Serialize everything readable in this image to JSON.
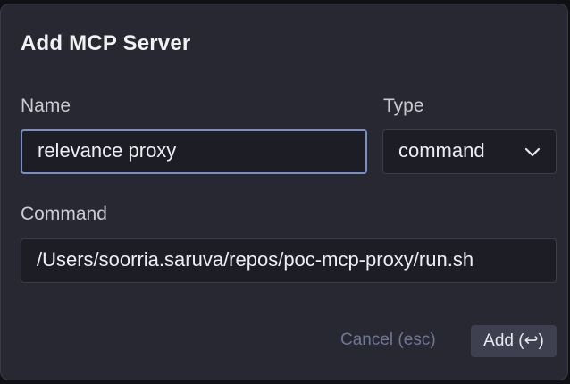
{
  "dialog": {
    "title": "Add MCP Server"
  },
  "form": {
    "name_label": "Name",
    "name_value": "relevance proxy",
    "type_label": "Type",
    "type_value": "command",
    "command_label": "Command",
    "command_value": "/Users/soorria.saruva/repos/poc-mcp-proxy/run.sh"
  },
  "actions": {
    "cancel_label": "Cancel (esc)",
    "add_label": "Add (↩)"
  },
  "icons": {
    "type_dropdown": "chevron-down-icon"
  },
  "colors": {
    "dialog_bg": "#272832",
    "focus_border": "#7a8fc7",
    "cancel_text": "#6f7797"
  }
}
